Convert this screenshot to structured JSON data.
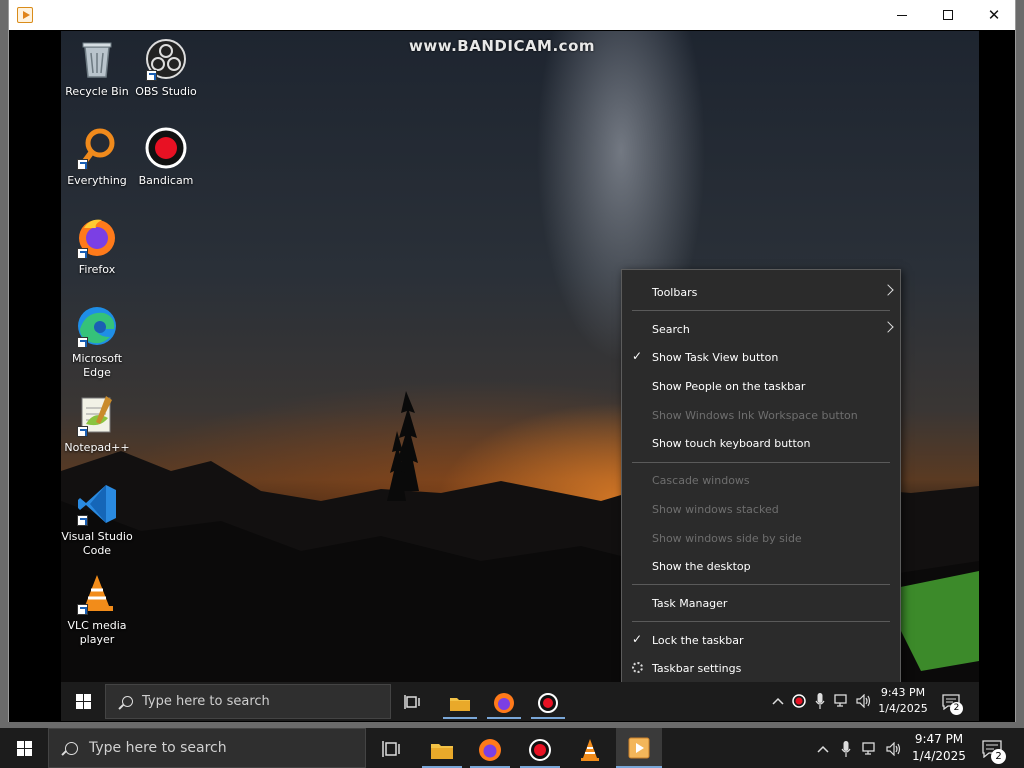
{
  "host_window": {
    "app_icon": "bandicam-play-icon",
    "controls": {
      "minimize": "minimize-icon",
      "maximize": "maximize-icon",
      "close": "close-icon",
      "close_glyph": "✕"
    }
  },
  "watermark": "www.BANDICAM.com",
  "desktop_icons": [
    {
      "label": "Recycle Bin",
      "icon": "recycle-bin-icon"
    },
    {
      "label": "OBS Studio",
      "icon": "obs-studio-icon"
    },
    {
      "label": "Everything",
      "icon": "everything-icon"
    },
    {
      "label": "Bandicam",
      "icon": "bandicam-icon"
    },
    {
      "label": "Firefox",
      "icon": "firefox-icon"
    },
    {
      "label": "Microsoft Edge",
      "icon": "edge-icon"
    },
    {
      "label": "Notepad++",
      "icon": "notepadpp-icon"
    },
    {
      "label": "Visual Studio Code",
      "icon": "vscode-icon"
    },
    {
      "label": "VLC media player",
      "icon": "vlc-icon"
    }
  ],
  "context_menu": {
    "check_glyph": "✓",
    "items": [
      {
        "label": "Toolbars",
        "enabled": true,
        "checked": false,
        "submenu": true
      },
      {
        "label": "Search",
        "enabled": true,
        "checked": false,
        "submenu": true
      },
      {
        "label": "Show Task View button",
        "enabled": true,
        "checked": true
      },
      {
        "label": "Show People on the taskbar",
        "enabled": true,
        "checked": false
      },
      {
        "label": "Show Windows Ink Workspace button",
        "enabled": false,
        "checked": false
      },
      {
        "label": "Show touch keyboard button",
        "enabled": true,
        "checked": false
      },
      {
        "label": "Cascade windows",
        "enabled": false,
        "checked": false
      },
      {
        "label": "Show windows stacked",
        "enabled": false,
        "checked": false
      },
      {
        "label": "Show windows side by side",
        "enabled": false,
        "checked": false
      },
      {
        "label": "Show the desktop",
        "enabled": true,
        "checked": false
      },
      {
        "label": "Task Manager",
        "enabled": true,
        "checked": false
      },
      {
        "label": "Lock the taskbar",
        "enabled": true,
        "checked": true
      },
      {
        "label": "Taskbar settings",
        "enabled": true,
        "checked": false,
        "icon": "gear-icon"
      }
    ]
  },
  "guest_taskbar": {
    "search_placeholder": "Type here to search",
    "time": "9:43 PM",
    "date": "1/4/2025",
    "notification_count": "2",
    "pinned": [
      "task-view-icon",
      "file-explorer-icon",
      "firefox-icon",
      "bandicam-icon"
    ],
    "tray": [
      "chevron-up-icon",
      "bandicam-record-icon",
      "microphone-icon",
      "network-icon",
      "volume-icon"
    ]
  },
  "host_taskbar": {
    "search_placeholder": "Type here to search",
    "time": "9:47 PM",
    "date": "1/4/2025",
    "notification_count": "2",
    "pinned": [
      "task-view-icon",
      "file-explorer-icon",
      "firefox-icon",
      "bandicam-icon",
      "vlc-icon",
      "bandicam-player-icon"
    ],
    "tray": [
      "chevron-up-icon",
      "microphone-icon",
      "network-icon",
      "volume-icon"
    ]
  },
  "colors": {
    "taskbar": "#1c1c1c",
    "menu_bg": "#2b2b2b",
    "accent": "#7aa7d8",
    "record_red": "#e81123"
  }
}
